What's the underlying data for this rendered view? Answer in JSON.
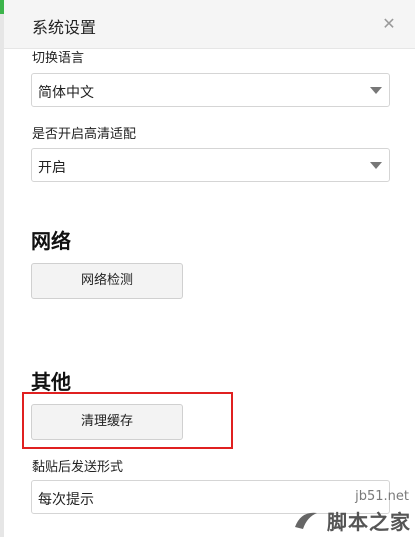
{
  "window": {
    "title": "系统设置"
  },
  "language": {
    "label": "切换语言",
    "selected": "简体中文"
  },
  "hd_adapt": {
    "label": "是否开启高清适配",
    "selected": "开启"
  },
  "network": {
    "heading": "网络",
    "check_button": "网络检测"
  },
  "other": {
    "heading": "其他",
    "clear_cache_button": "清理缓存"
  },
  "paste_send": {
    "label": "黏贴后发送形式",
    "selected": "每次提示"
  },
  "watermark": {
    "url": "jb51.net",
    "brand": "脚本之家"
  },
  "colors": {
    "highlight": "#e02020",
    "accent_green": "#3cb44b"
  },
  "icons": {
    "close": "close-icon",
    "dropdown": "chevron-down-icon"
  }
}
